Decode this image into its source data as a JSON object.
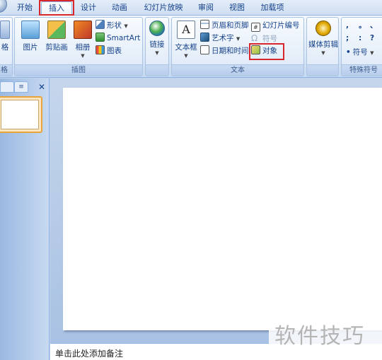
{
  "tabs": [
    "开始",
    "插入",
    "设计",
    "动画",
    "幻灯片放映",
    "审阅",
    "视图",
    "加载项"
  ],
  "ribbon": {
    "group_partial_left": {
      "button": "格",
      "label": "格"
    },
    "illustrations": {
      "label": "插图",
      "picture": "图片",
      "clipart": "剪贴画",
      "album": "相册",
      "shapes": "形状",
      "smartart": "SmartArt",
      "chart": "图表"
    },
    "links": {
      "label": "",
      "link": "链接"
    },
    "text": {
      "label": "文本",
      "textbox": "文本框",
      "header_footer": "页眉和页脚",
      "wordart": "艺术字",
      "datetime": "日期和时间",
      "slide_number": "幻灯片编号",
      "symbol": "符号",
      "object": "对象"
    },
    "media": {
      "label": "",
      "media_clips": "媒体剪辑"
    },
    "special_symbols": {
      "label": "特殊符号",
      "symbols": [
        ",",
        "。",
        "、",
        ";",
        ":",
        "?"
      ],
      "symbol_button": "符号"
    }
  },
  "notes": {
    "placeholder": "单击此处添加备注"
  },
  "watermark": "软件技巧",
  "colors": {
    "highlight": "#d8262c",
    "ribbon_text": "#15428b"
  }
}
